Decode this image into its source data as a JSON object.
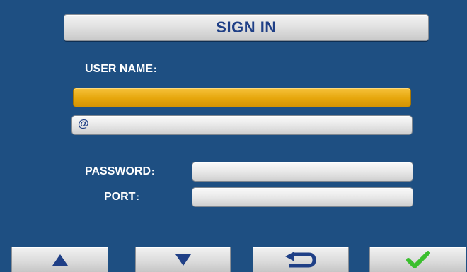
{
  "header": {
    "title": "SIGN IN"
  },
  "form": {
    "username_label": "USER NAME",
    "username_value": "",
    "email_prefix": "@",
    "email_value": "",
    "password_label": "PASSWORD",
    "password_value": "",
    "port_label": "PORT",
    "port_value": "",
    "label_colon": ":"
  },
  "footer": {
    "buttons": [
      {
        "icon": "triangle-up-icon"
      },
      {
        "icon": "triangle-down-icon"
      },
      {
        "icon": "return-arrow-icon"
      },
      {
        "icon": "checkmark-icon"
      }
    ]
  },
  "colors": {
    "background": "#1e4f82",
    "title_text": "#1f3f86",
    "active_field": "#e6a60c",
    "arrow_icon": "#1f3f86",
    "check_icon": "#3bbf2e"
  }
}
